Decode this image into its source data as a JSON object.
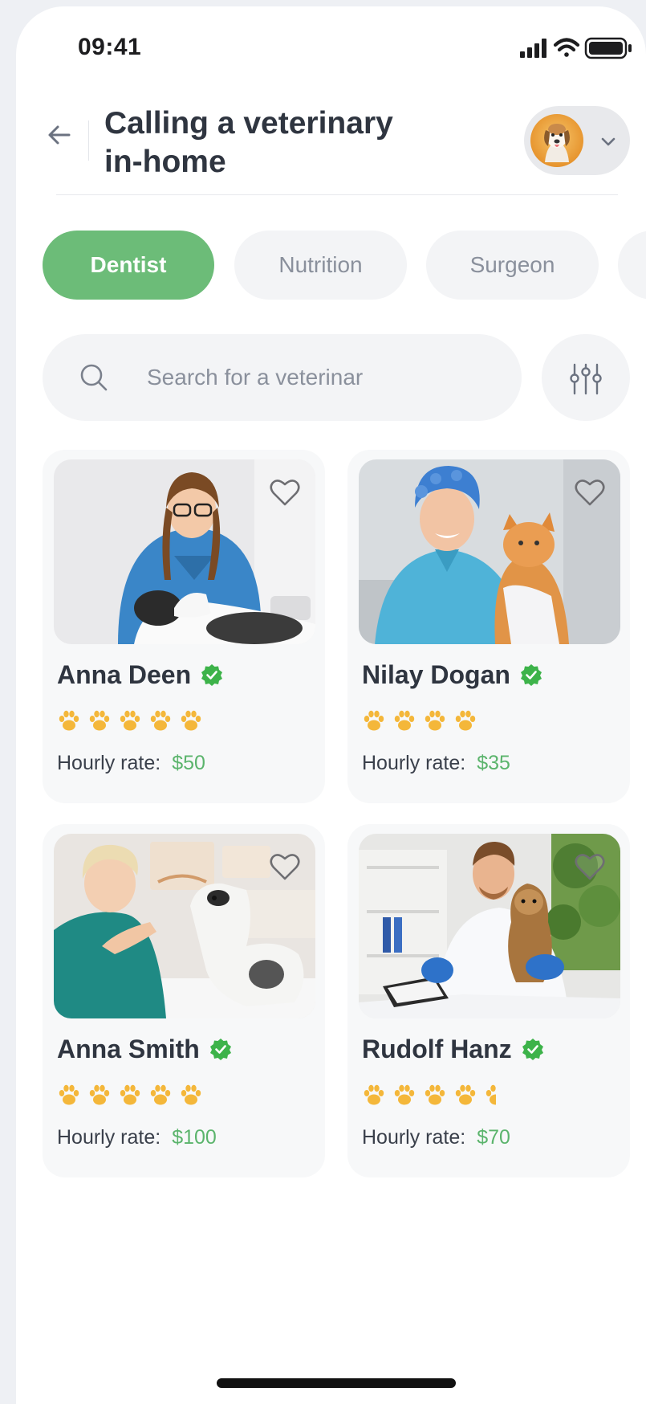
{
  "status_bar": {
    "time": "09:41",
    "icons": [
      "signal-icon",
      "wifi-icon",
      "battery-icon"
    ]
  },
  "header": {
    "title_line1": "Calling a veterinary",
    "title_line2": "in-home",
    "back_icon": "back-arrow-icon",
    "profile_chevron_icon": "chevron-down-icon"
  },
  "categories": [
    {
      "label": "Dentist",
      "active": true
    },
    {
      "label": "Nutrition",
      "active": false
    },
    {
      "label": "Surgeon",
      "active": false
    }
  ],
  "search": {
    "placeholder": "Search for a veterinar",
    "icon": "search-icon",
    "filter_icon": "filter-sliders-icon"
  },
  "vets": [
    {
      "name": "Anna Deen",
      "verified": true,
      "rating": 5,
      "rate_label": "Hourly rate:",
      "price": "$50"
    },
    {
      "name": "Nilay Dogan",
      "verified": true,
      "rating": 4,
      "rate_label": "Hourly rate:",
      "price": "$35"
    },
    {
      "name": "Anna Smith",
      "verified": true,
      "rating": 5,
      "rate_label": "Hourly rate:",
      "price": "$100"
    },
    {
      "name": "Rudolf Hanz",
      "verified": true,
      "rating": 4.5,
      "rate_label": "Hourly rate:",
      "price": "$70"
    }
  ],
  "colors": {
    "accent_green": "#6cbc78",
    "price_green": "#5bb46c",
    "verified_green": "#3db34a",
    "paw_yellow": "#f4b73a",
    "title_text": "#2f3540",
    "muted_text": "#8a909c"
  }
}
